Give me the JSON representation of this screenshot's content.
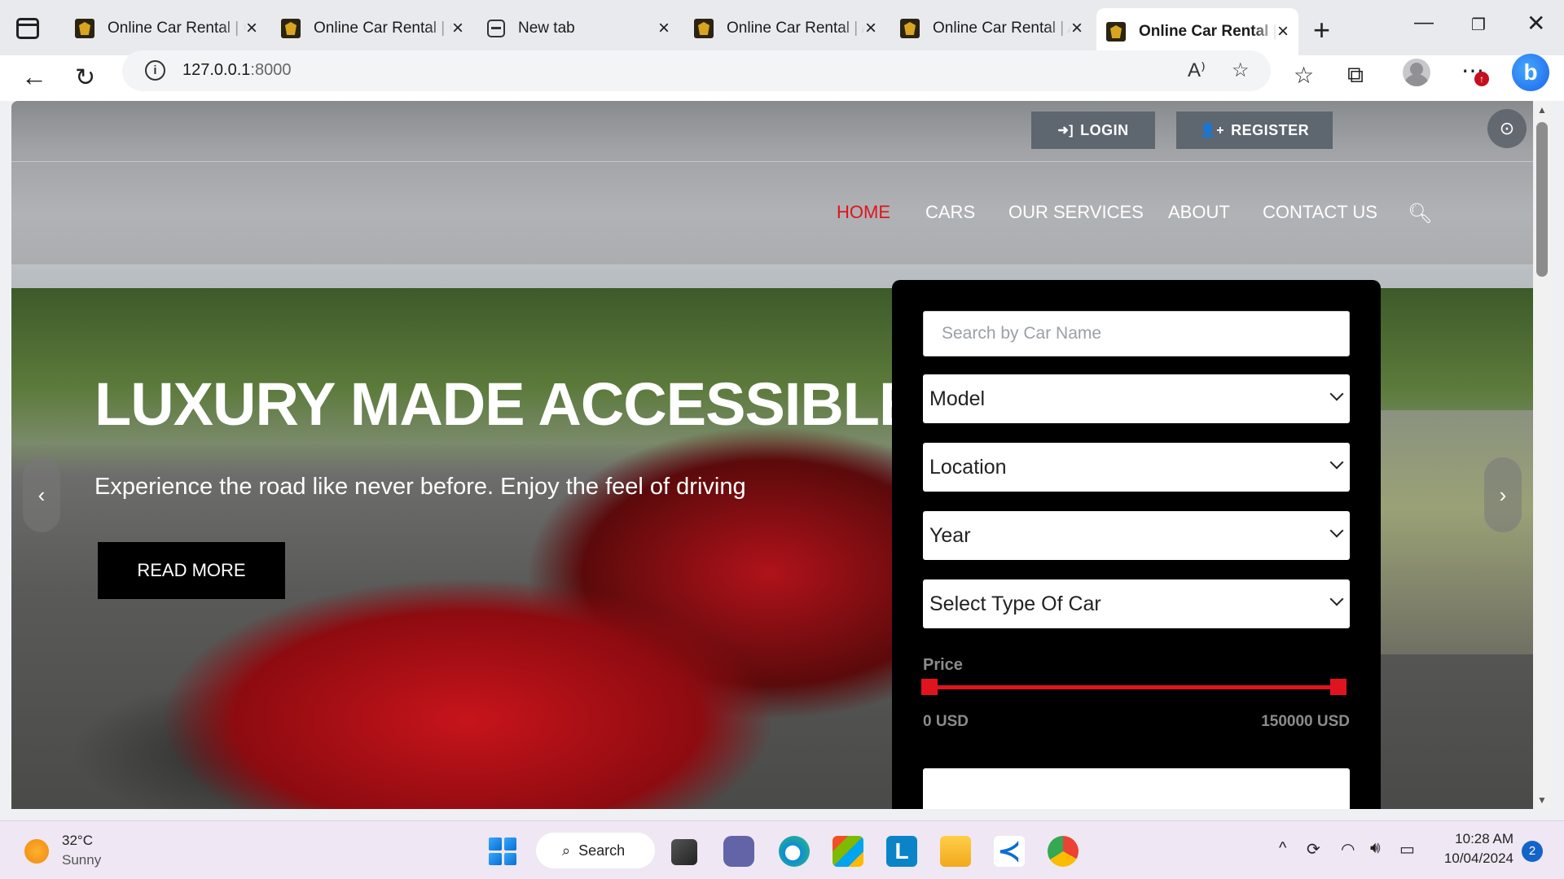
{
  "browser": {
    "tabs": [
      {
        "title": "Online Car Rental | Car Listing",
        "favicon": "site-logo-icon",
        "active": false
      },
      {
        "title": "Online Car Rental | Car Listing",
        "favicon": "site-logo-icon",
        "active": false
      },
      {
        "title": "New tab",
        "favicon": "new-tab-icon",
        "active": false
      },
      {
        "title": "Online Car Rental | Admin",
        "favicon": "site-logo-icon",
        "active": false
      },
      {
        "title": "Online Car Rental | Admin",
        "favicon": "site-logo-icon",
        "active": false
      },
      {
        "title": "Online Car Rental | Home",
        "favicon": "site-logo-icon",
        "active": true
      }
    ],
    "address": {
      "host": "127.0.0.1",
      "port": ":8000"
    }
  },
  "header": {
    "login_label": "LOGIN",
    "register_label": "REGISTER",
    "nav": [
      {
        "label": "HOME",
        "active": true
      },
      {
        "label": "CARS",
        "active": false
      },
      {
        "label": "OUR SERVICES",
        "active": false
      },
      {
        "label": "ABOUT",
        "active": false
      },
      {
        "label": "CONTACT US",
        "active": false
      }
    ]
  },
  "hero": {
    "title": "LUXURY MADE ACCESSIBLE.",
    "subtitle": "Experience the road like never before. Enjoy the feel of driving",
    "cta_label": "READ MORE"
  },
  "search_panel": {
    "name_placeholder": "Search by Car Name",
    "model_label": "Model",
    "location_label": "Location",
    "year_label": "Year",
    "type_label": "Select Type Of Car",
    "price_label": "Price",
    "price_min": "0 USD",
    "price_max": "150000 USD",
    "price_range_fraction": [
      0,
      1
    ]
  },
  "taskbar": {
    "weather_temp": "32°C",
    "weather_desc": "Sunny",
    "search_label": "Search",
    "time": "10:28 AM",
    "date": "10/04/2024",
    "notifications": "2"
  },
  "colors": {
    "accent": "#e0141e",
    "panel_bg": "#000000",
    "auth_btn_bg": "#5e6670"
  }
}
